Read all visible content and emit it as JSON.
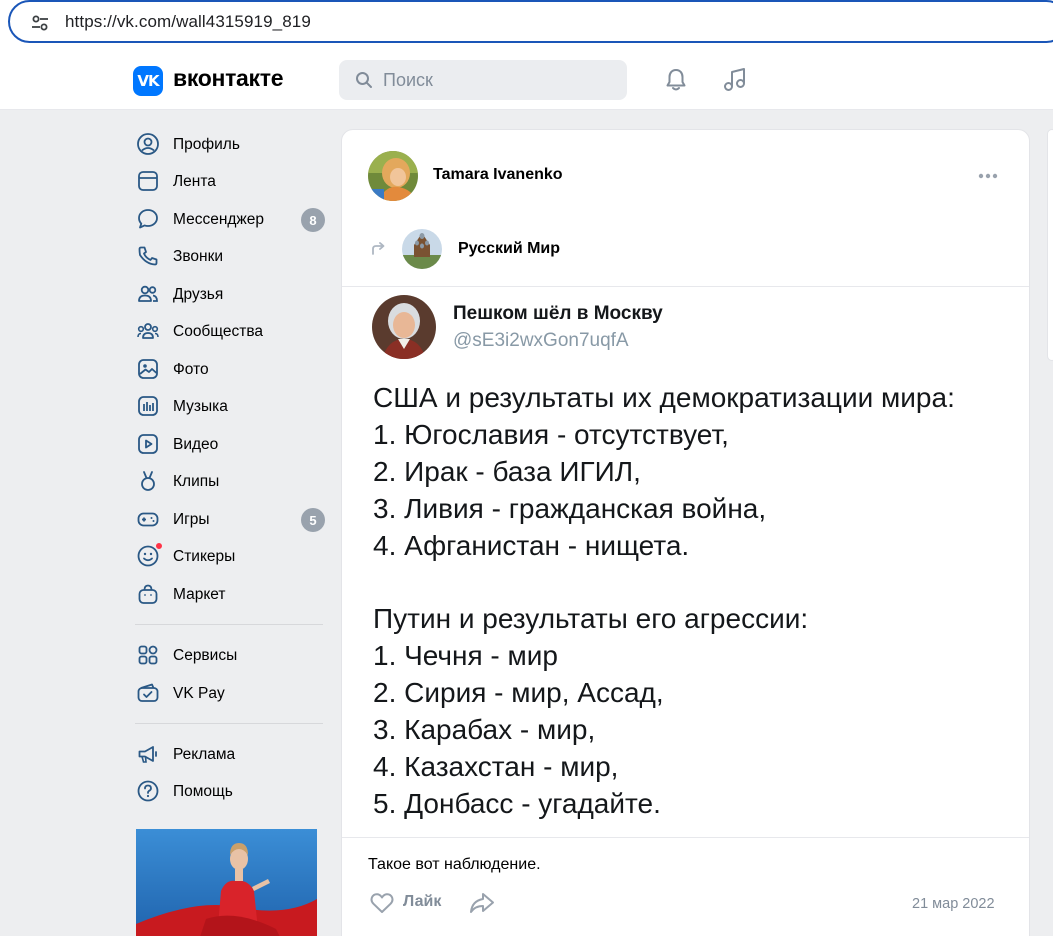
{
  "browser": {
    "url": "https://vk.com/wall4315919_819"
  },
  "header": {
    "logo_text": "VK",
    "brand": "вконтакте",
    "search_placeholder": "Поиск"
  },
  "nav": {
    "items": [
      {
        "label": "Профиль",
        "icon": "profile-icon"
      },
      {
        "label": "Лента",
        "icon": "feed-icon"
      },
      {
        "label": "Мессенджер",
        "icon": "messenger-icon",
        "badge": "8"
      },
      {
        "label": "Звонки",
        "icon": "phone-icon"
      },
      {
        "label": "Друзья",
        "icon": "friends-icon"
      },
      {
        "label": "Сообщества",
        "icon": "communities-icon"
      },
      {
        "label": "Фото",
        "icon": "photo-icon"
      },
      {
        "label": "Музыка",
        "icon": "music-icon"
      },
      {
        "label": "Видео",
        "icon": "video-icon"
      },
      {
        "label": "Клипы",
        "icon": "clips-icon"
      },
      {
        "label": "Игры",
        "icon": "games-icon",
        "badge": "5"
      },
      {
        "label": "Стикеры",
        "icon": "stickers-icon"
      },
      {
        "label": "Маркет",
        "icon": "market-icon"
      },
      {
        "label": "Сервисы",
        "icon": "services-icon"
      },
      {
        "label": "VK Pay",
        "icon": "vkpay-icon"
      },
      {
        "label": "Реклама",
        "icon": "ads-icon"
      },
      {
        "label": "Помощь",
        "icon": "help-icon"
      }
    ]
  },
  "post": {
    "author": "Tamara Ivanenko",
    "group": "Русский Мир",
    "tweet": {
      "name": "Пешком шёл в Москву",
      "handle": "@sE3i2wxGon7uqfA",
      "lines": [
        "США и результаты их демократизации мира:",
        "1. Югославия - отсутствует,",
        "2. Ирак - база ИГИЛ,",
        "3. Ливия - гражданская война,",
        "4. Афганистан - нищета.",
        "Путин и результаты его агрессии:",
        "1. Чечня - мир",
        "2. Сирия - мир, Ассад,",
        "3. Карабах - мир,",
        "4. Казахстан - мир,",
        "5. Донбасс - угадайте."
      ]
    },
    "text": "Такое вот наблюдение.",
    "like_label": "Лайк",
    "date": "21 мар 2022"
  },
  "colors": {
    "accent": "#0077ff",
    "icon_blue": "#2a5885",
    "muted": "#818c99",
    "badge": "#99a2ad",
    "background": "#edeef0"
  }
}
